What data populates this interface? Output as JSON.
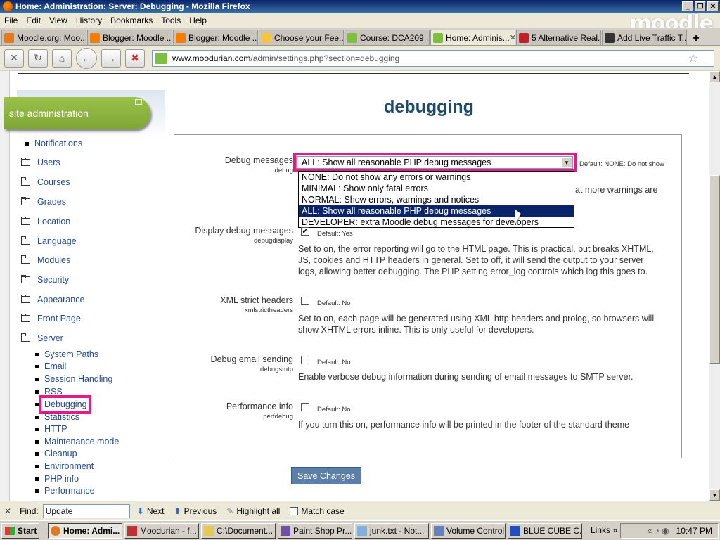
{
  "window": {
    "title": "Home: Administration: Server: Debugging - Mozilla Firefox"
  },
  "menu": [
    "File",
    "Edit",
    "View",
    "History",
    "Bookmarks",
    "Tools",
    "Help"
  ],
  "brand": "moodle",
  "tabs": [
    {
      "label": "Moodle.org: Moo...",
      "color": "#e07b20"
    },
    {
      "label": "Blogger: Moodle ...",
      "color": "#f57d00"
    },
    {
      "label": "Blogger: Moodle ...",
      "color": "#f57d00"
    },
    {
      "label": "Choose your Fee...",
      "color": "#f5c542"
    },
    {
      "label": "Course: DCA209 ...",
      "color": "#7fbf3f"
    },
    {
      "label": "Home: Adminis...",
      "color": "#7fbf3f",
      "close": "✕"
    },
    {
      "label": "5 Alternative Real...",
      "color": "#c0202a"
    },
    {
      "label": "Add Live Traffic T...",
      "color": "#333333"
    }
  ],
  "url": {
    "domain": "www.moodurian.com",
    "path": "/admin/settings.php?section=debugging"
  },
  "sidebar": {
    "header": "site administration",
    "notifications": "Notifications",
    "folders": [
      "Users",
      "Courses",
      "Grades",
      "Location",
      "Language",
      "Modules",
      "Security",
      "Appearance",
      "Front Page",
      "Server"
    ],
    "server_items": [
      "System Paths",
      "Email",
      "Session Handling",
      "RSS",
      "Debugging",
      "Statistics",
      "HTTP",
      "Maintenance mode",
      "Cleanup",
      "Environment",
      "PHP info",
      "Performance"
    ]
  },
  "page": {
    "title": "debugging"
  },
  "settings": {
    "debug": {
      "label": "Debug messages",
      "key": "debug",
      "value": "ALL: Show all reasonable PHP debug messages",
      "default": "Default: NONE: Do not show",
      "desc_tail": "at more warnings are",
      "options": [
        "NONE: Do not show any errors or warnings",
        "MINIMAL: Show only fatal errors",
        "NORMAL: Show errors, warnings and notices",
        "ALL: Show all reasonable PHP debug messages",
        "DEVELOPER: extra Moodle debug messages for developers"
      ]
    },
    "debugdisplay": {
      "label": "Display debug messages",
      "key": "debugdisplay",
      "checked": true,
      "default": "Default: Yes",
      "desc": [
        "Set to on, the error reporting will go to the HTML page. This is practical, but breaks XHTML,",
        "JS, cookies and HTTP headers in general. Set to off, it will send the output to your server",
        "logs, allowing better debugging. The PHP setting error_log controls which log this goes to."
      ]
    },
    "xmlstrictheaders": {
      "label": "XML strict headers",
      "key": "xmlstrictheaders",
      "default": "Default: No",
      "desc": [
        "Set to on, each page will be generated using XML http headers and prolog, so browsers will",
        "show XHTML errors inline. This is only useful for developers."
      ]
    },
    "debugsmtp": {
      "label": "Debug email sending",
      "key": "debugsmtp",
      "default": "Default: No",
      "desc": [
        "Enable verbose debug information during sending of email messages to SMTP server."
      ]
    },
    "perfdebug": {
      "label": "Performance info",
      "key": "perfdebug",
      "default": "Default: No",
      "desc": [
        "If you turn this on, performance info will be printed in the footer of the standard theme"
      ]
    }
  },
  "save_button": "Save Changes",
  "findbar": {
    "label": "Find:",
    "value": "Update",
    "next": "Next",
    "previous": "Previous",
    "highlight": "Highlight all",
    "match_case": "Match case"
  },
  "taskbar": {
    "start": "Start",
    "tasks": [
      "Home: Admi...",
      "Moodurian - f...",
      "C:\\Document...",
      "Paint Shop Pr...",
      "junk.txt - Not...",
      "Volume Control",
      "BLUE CUBE C..."
    ],
    "links": "Links",
    "time": "10:47 PM"
  },
  "colors": {
    "highlight": "#e8178a",
    "title": "#1f4a6a",
    "header_green": "#8fb83f",
    "button": "#5b7fa8"
  }
}
